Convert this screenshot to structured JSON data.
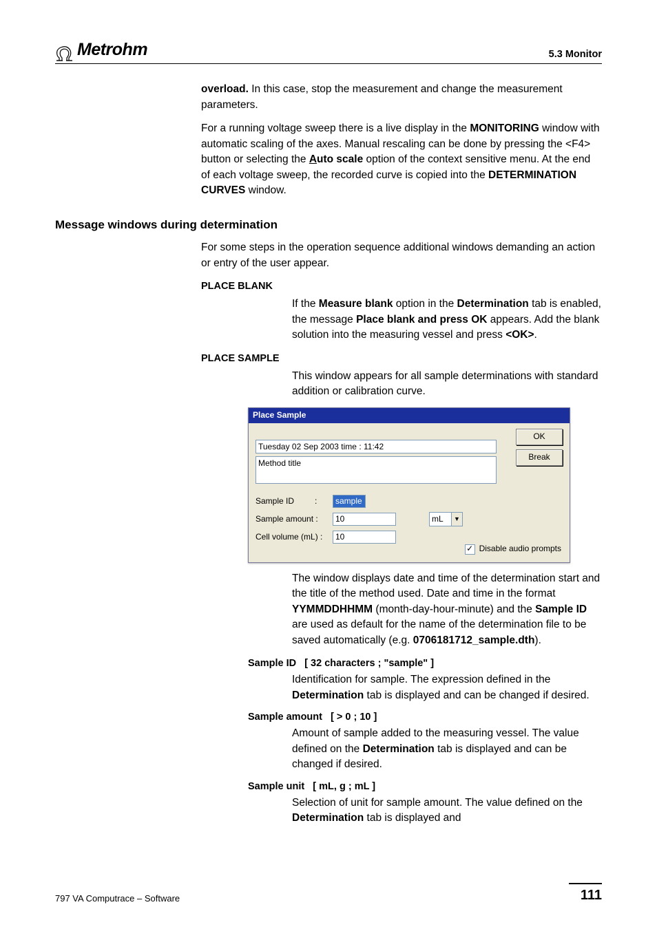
{
  "header": {
    "brand": "Metrohm",
    "section": "5.3  Monitor"
  },
  "paragraph_overload_pre": " In this case, stop the measurement and change the measurement parameters.",
  "overload_word": "overload.",
  "paragraph_running_parts": {
    "p1": "For a running voltage sweep there is a live display in the ",
    "monitoring": "MONITORING",
    "p2": " window with automatic scaling of the axes. Manual rescaling can be done by pressing the <F4> button or selecting the ",
    "autoscale_u": "A",
    "autoscale_rest": "uto scale",
    "p3": " option of the context sensitive menu. At the end of each voltage sweep, the recorded curve is copied into the ",
    "detcurves": "DETERMINATION CURVES",
    "p4": " window."
  },
  "heading_msg": "Message windows during determination",
  "msg_intro": "For some steps in the operation sequence additional windows demanding an action or entry of the user appear.",
  "place_blank": {
    "title": "PLACE BLANK",
    "p_a": "If the ",
    "mb": "Measure blank",
    "p_b": " option in the ",
    "det": "Determination",
    "p_c": " tab is enabled, the message ",
    "pbpo": "Place blank and press OK",
    "p_d": " appears. Add the blank solution into the measuring vessel and press ",
    "ok": "<OK>",
    "p_e": "."
  },
  "place_sample": {
    "title": "PLACE SAMPLE",
    "intro": "This window appears for all sample determinations with standard addition or calibration curve.",
    "win": {
      "title": "Place Sample",
      "datetime": "Tuesday 02 Sep 2003  time : 11:42",
      "method_title": "Method title",
      "sample_id_label": "Sample ID",
      "sample_id_value": "sample",
      "sample_amount_label": "Sample amount  :",
      "sample_amount_value": "10",
      "sample_unit_value": "mL",
      "cell_volume_label": "Cell volume (mL) :",
      "cell_volume_value": "10",
      "ok_btn": "OK",
      "break_btn": "Break",
      "disable_audio": "Disable audio prompts"
    },
    "post_para": {
      "a": "The window displays date and time of the determination start and the title of the method used. Date and time in the format ",
      "fmt": "YYMMDDHHMM",
      "b": " (month-day-hour-minute) and the ",
      "sid": "Sample ID",
      "c": " are used as default for the name of the determination file to be saved automatically (e.g. ",
      "fn": "0706181712_sample.dth",
      "d": ")."
    }
  },
  "defs": {
    "sid": {
      "label": "Sample ID",
      "range": "[ 32 characters ; \"sample\" ]",
      "body_a": "Identification for sample. The expression defined in the ",
      "det": "Determination",
      "body_b": " tab is displayed and can be changed if desired."
    },
    "samount": {
      "label": "Sample amount",
      "range": "[ > 0 ; 10 ]",
      "body_a": "Amount of sample added to the measuring vessel. The value defined on the ",
      "det": "Determination",
      "body_b": " tab is displayed and can be changed if desired."
    },
    "sunit": {
      "label": "Sample unit",
      "range": "[ mL, g ; mL ]",
      "body_a": "Selection of unit for sample amount. The value defined on the ",
      "det": "Determination",
      "body_b": " tab is displayed and"
    }
  },
  "footer": {
    "left": "797 VA Computrace – Software",
    "page": "111"
  }
}
